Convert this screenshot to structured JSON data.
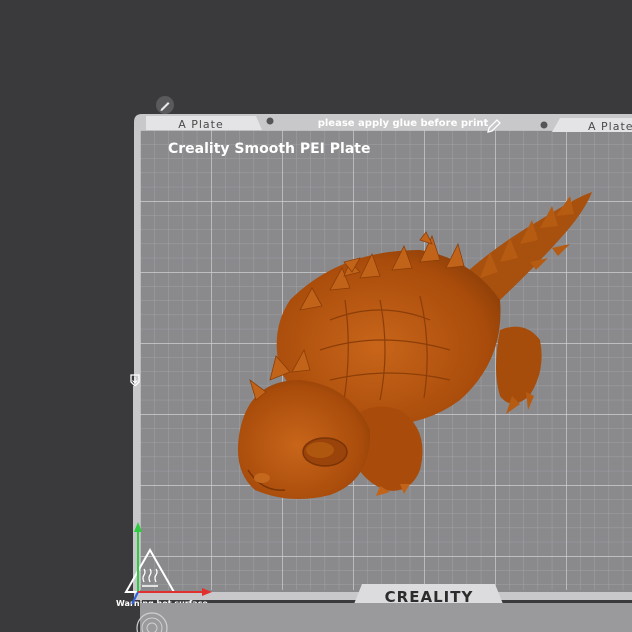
{
  "plate": {
    "tab_left_label": "A Plate",
    "tab_right_label": "A Plate",
    "notice": "please apply glue before print",
    "plate_type": "Creality Smooth PEI Plate",
    "brand": "CREALITY",
    "warning": "Warning hot surface"
  },
  "colors": {
    "background": "#3a3a3c",
    "bed": "#8a8a8d",
    "grid": "#b4b4b6",
    "model": "#b8560e"
  },
  "icons": {
    "edit_plate_name": "pencil-icon",
    "edit_notice": "pencil-icon",
    "home_marker": "home-arrow-icon",
    "hot_surface": "hot-surface-warning-icon",
    "axis_gizmo": "xyz-axis-icon"
  }
}
